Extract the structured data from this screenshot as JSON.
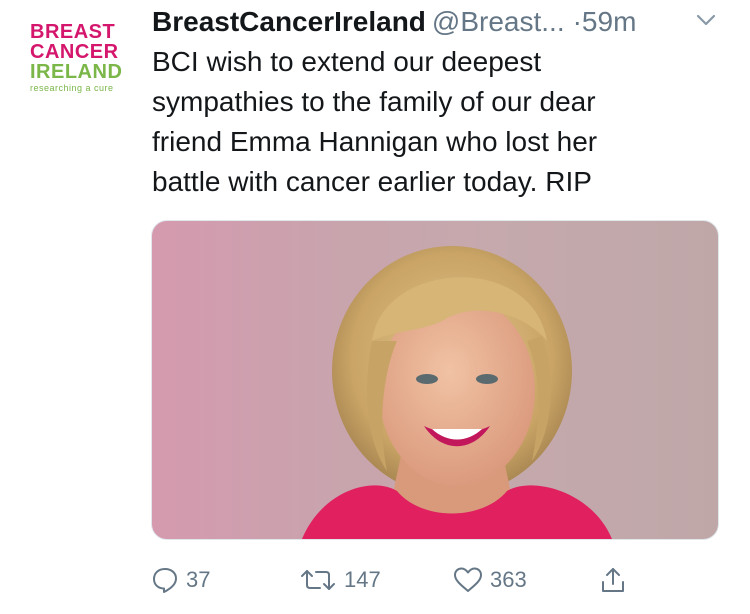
{
  "account": {
    "display_name": "BreastCancerIreland",
    "handle": "@Breast...",
    "separator": "·",
    "time": "59m"
  },
  "avatar": {
    "line1": "BREAST",
    "line2": "CANCER",
    "line3": "IRELAND",
    "line4": "researching a cure"
  },
  "tweet": {
    "lines": [
      "BCI wish to extend our deepest",
      "sympathies to the family of our dear",
      "friend Emma Hannigan who lost her",
      "battle with cancer earlier today. RIP"
    ]
  },
  "actions": {
    "reply_count": "37",
    "retweet_count": "147",
    "like_count": "363"
  },
  "colors": {
    "brand_pink": "#d5166d",
    "brand_green": "#7ab648",
    "muted": "#657786"
  }
}
